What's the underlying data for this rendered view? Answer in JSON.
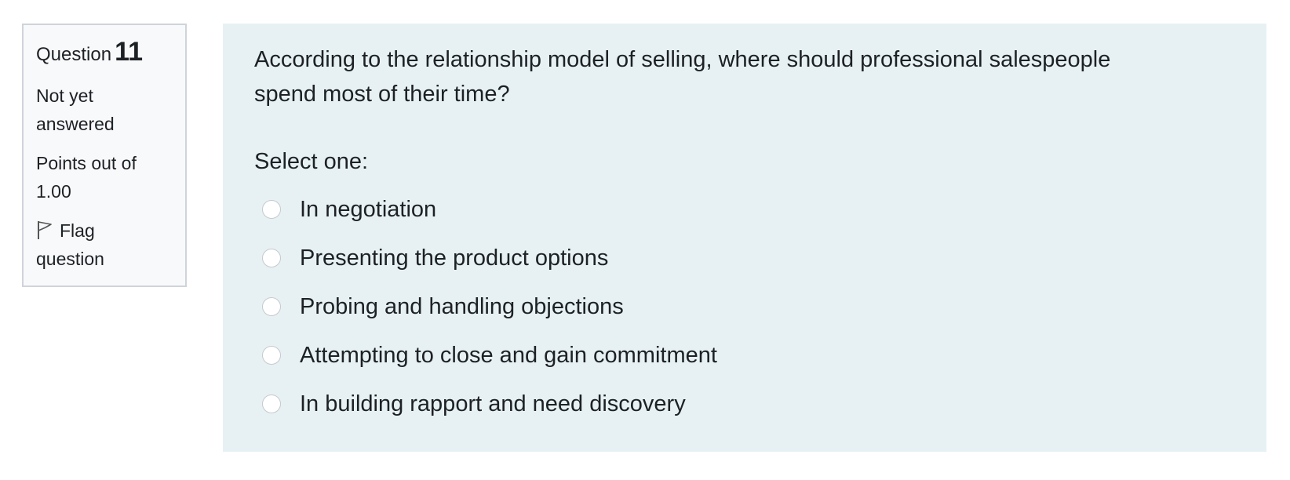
{
  "info": {
    "question_label": "Question",
    "question_number": "11",
    "state_line1": "Not yet",
    "state_line2": "answered",
    "grade_line1": "Points out of",
    "grade_line2": "1.00",
    "flag_icon": "flag-icon",
    "flag_line1": "Flag",
    "flag_line2": "question"
  },
  "question": {
    "text_line1": "According to the relationship model of selling, where should professional salespeople",
    "text_line2": "spend most of their time?",
    "prompt": "Select one:",
    "answers": [
      {
        "label": "In negotiation",
        "selected": false
      },
      {
        "label": "Presenting the product options",
        "selected": false
      },
      {
        "label": "Probing and handling objections",
        "selected": false
      },
      {
        "label": "Attempting to close and gain commitment",
        "selected": false
      },
      {
        "label": "In building rapport and need discovery",
        "selected": false
      }
    ]
  },
  "colors": {
    "content_background": "#e7f1f4",
    "info_background": "#f8f9fa",
    "info_border": "#cfd4da",
    "text": "#1d2125"
  }
}
